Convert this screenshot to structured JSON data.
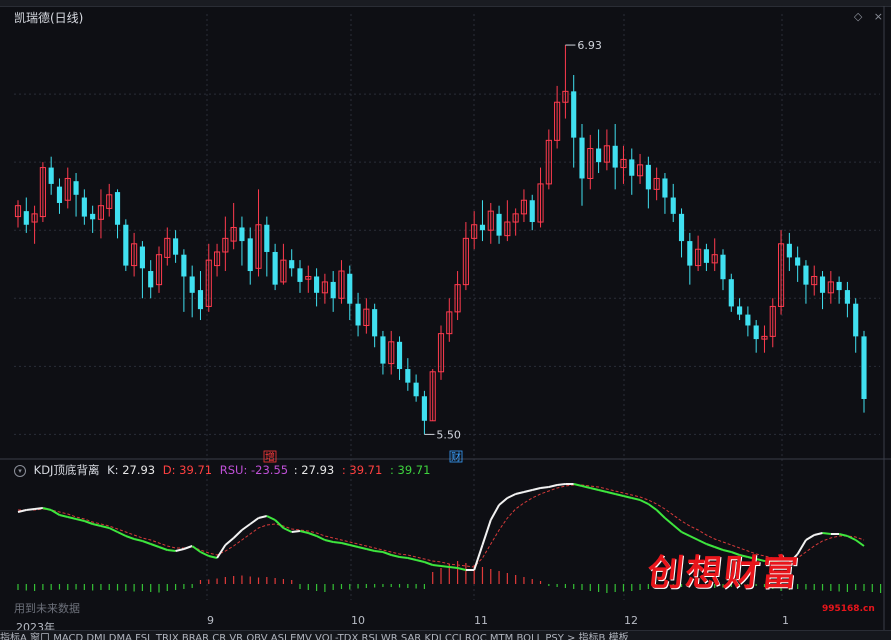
{
  "panel": {
    "title": "凯瑞德(日线)",
    "icons": [
      "diamond-icon",
      "close-icon"
    ]
  },
  "price_labels": {
    "high": "6.93",
    "low": "5.50"
  },
  "markers": [
    {
      "text": "增",
      "color": "#ff3b3b"
    },
    {
      "text": "财",
      "color": "#3aa0ff"
    }
  ],
  "indicator": {
    "toggle_icon": "chevron-down-icon",
    "name": "KDJ顶底背离",
    "k_label": "K:",
    "k_value": "27.93",
    "d_label": "D:",
    "d_value": "39.71",
    "rsu_label": "RSU:",
    "rsu_value": "-23.55",
    "v1": ": 27.93",
    "v2": ": 39.71",
    "v3": ": 39.71"
  },
  "note": "用到未来数据",
  "x_axis": {
    "year": "2023年",
    "months": [
      "9",
      "10",
      "11",
      "12",
      "1"
    ]
  },
  "bottom_tabs": "指标A  窗口  MACD  DMI  DMA  FSL  TRIX  BRAR  CR  VR  OBV  ASI  EMV  VOL-TDX  RSI  WR  SAR  KDJ  CCI  ROC  MTM  BOLL  PSY  >   指标B  模板",
  "watermark": {
    "text": "创想财富",
    "url": "995168.cn"
  },
  "chart_data": {
    "type": "candlestick",
    "title": "凯瑞德(日线)",
    "annotated_high": 6.93,
    "annotated_low": 5.5,
    "ylim": [
      5.45,
      7.0
    ],
    "candles": [
      [
        6.3,
        6.34,
        6.26,
        6.36
      ],
      [
        6.32,
        6.27,
        6.24,
        6.37
      ],
      [
        6.28,
        6.31,
        6.2,
        6.34
      ],
      [
        6.3,
        6.48,
        6.28,
        6.5
      ],
      [
        6.48,
        6.42,
        6.38,
        6.52
      ],
      [
        6.41,
        6.35,
        6.31,
        6.44
      ],
      [
        6.36,
        6.44,
        6.33,
        6.48
      ],
      [
        6.43,
        6.38,
        6.3,
        6.46
      ],
      [
        6.37,
        6.3,
        6.27,
        6.4
      ],
      [
        6.31,
        6.29,
        6.24,
        6.34
      ],
      [
        6.29,
        6.34,
        6.22,
        6.4
      ],
      [
        6.33,
        6.38,
        6.3,
        6.42
      ],
      [
        6.39,
        6.27,
        6.22,
        6.4
      ],
      [
        6.27,
        6.12,
        6.1,
        6.29
      ],
      [
        6.12,
        6.2,
        6.08,
        6.24
      ],
      [
        6.19,
        6.11,
        6.0,
        6.21
      ],
      [
        6.1,
        6.04,
        6.0,
        6.14
      ],
      [
        6.05,
        6.16,
        6.02,
        6.19
      ],
      [
        6.15,
        6.22,
        6.12,
        6.26
      ],
      [
        6.22,
        6.16,
        6.13,
        6.25
      ],
      [
        6.16,
        6.08,
        5.95,
        6.18
      ],
      [
        6.08,
        6.02,
        5.93,
        6.12
      ],
      [
        6.03,
        5.96,
        5.92,
        6.1
      ],
      [
        5.97,
        6.14,
        5.95,
        6.2
      ],
      [
        6.12,
        6.17,
        6.08,
        6.2
      ],
      [
        6.17,
        6.22,
        6.1,
        6.3
      ],
      [
        6.21,
        6.26,
        6.18,
        6.35
      ],
      [
        6.26,
        6.21,
        6.12,
        6.3
      ],
      [
        6.22,
        6.1,
        6.05,
        6.26
      ],
      [
        6.11,
        6.27,
        6.08,
        6.4
      ],
      [
        6.27,
        6.17,
        6.08,
        6.3
      ],
      [
        6.17,
        6.05,
        6.03,
        6.2
      ],
      [
        6.06,
        6.14,
        6.05,
        6.2
      ],
      [
        6.14,
        6.11,
        6.08,
        6.18
      ],
      [
        6.11,
        6.06,
        6.02,
        6.14
      ],
      [
        6.07,
        6.08,
        6.02,
        6.12
      ],
      [
        6.08,
        6.02,
        5.97,
        6.11
      ],
      [
        6.02,
        6.06,
        5.98,
        6.09
      ],
      [
        6.06,
        6.0,
        5.95,
        6.1
      ],
      [
        6.0,
        6.1,
        5.98,
        6.14
      ],
      [
        6.09,
        5.98,
        5.92,
        6.12
      ],
      [
        5.98,
        5.9,
        5.86,
        6.02
      ],
      [
        5.9,
        5.96,
        5.87,
        6.0
      ],
      [
        5.96,
        5.86,
        5.82,
        5.98
      ],
      [
        5.86,
        5.76,
        5.72,
        5.88
      ],
      [
        5.76,
        5.84,
        5.72,
        5.88
      ],
      [
        5.84,
        5.74,
        5.7,
        5.86
      ],
      [
        5.74,
        5.69,
        5.66,
        5.78
      ],
      [
        5.69,
        5.64,
        5.62,
        5.72
      ],
      [
        5.64,
        5.55,
        5.5,
        5.66
      ],
      [
        5.55,
        5.73,
        5.55,
        5.74
      ],
      [
        5.73,
        5.87,
        5.7,
        5.9
      ],
      [
        5.87,
        5.95,
        5.84,
        6.0
      ],
      [
        5.95,
        6.05,
        5.92,
        6.1
      ],
      [
        6.05,
        6.22,
        6.03,
        6.28
      ],
      [
        6.22,
        6.27,
        6.18,
        6.32
      ],
      [
        6.27,
        6.25,
        6.21,
        6.36
      ],
      [
        6.25,
        6.32,
        6.2,
        6.35
      ],
      [
        6.31,
        6.23,
        6.2,
        6.34
      ],
      [
        6.23,
        6.28,
        6.21,
        6.36
      ],
      [
        6.28,
        6.31,
        6.23,
        6.33
      ],
      [
        6.31,
        6.36,
        6.28,
        6.4
      ],
      [
        6.36,
        6.28,
        6.25,
        6.38
      ],
      [
        6.28,
        6.42,
        6.26,
        6.48
      ],
      [
        6.42,
        6.58,
        6.4,
        6.62
      ],
      [
        6.58,
        6.72,
        6.55,
        6.78
      ],
      [
        6.72,
        6.76,
        6.66,
        6.93
      ],
      [
        6.76,
        6.59,
        6.48,
        6.82
      ],
      [
        6.59,
        6.44,
        6.34,
        6.64
      ],
      [
        6.44,
        6.55,
        6.4,
        6.6
      ],
      [
        6.55,
        6.5,
        6.46,
        6.62
      ],
      [
        6.5,
        6.56,
        6.47,
        6.62
      ],
      [
        6.56,
        6.48,
        6.4,
        6.64
      ],
      [
        6.48,
        6.51,
        6.42,
        6.56
      ],
      [
        6.51,
        6.45,
        6.38,
        6.55
      ],
      [
        6.45,
        6.49,
        6.42,
        6.53
      ],
      [
        6.49,
        6.4,
        6.33,
        6.52
      ],
      [
        6.4,
        6.44,
        6.36,
        6.48
      ],
      [
        6.44,
        6.37,
        6.31,
        6.46
      ],
      [
        6.37,
        6.31,
        6.28,
        6.42
      ],
      [
        6.31,
        6.21,
        6.15,
        6.33
      ],
      [
        6.21,
        6.12,
        6.05,
        6.24
      ],
      [
        6.12,
        6.18,
        6.1,
        6.23
      ],
      [
        6.18,
        6.13,
        6.1,
        6.2
      ],
      [
        6.13,
        6.16,
        6.1,
        6.22
      ],
      [
        6.16,
        6.07,
        6.03,
        6.18
      ],
      [
        6.07,
        5.97,
        5.95,
        6.09
      ],
      [
        5.97,
        5.94,
        5.92,
        6.0
      ],
      [
        5.94,
        5.9,
        5.86,
        5.97
      ],
      [
        5.9,
        5.85,
        5.8,
        5.92
      ],
      [
        5.85,
        5.86,
        5.8,
        5.9
      ],
      [
        5.86,
        5.97,
        5.82,
        6.0
      ],
      [
        5.97,
        6.2,
        5.94,
        6.25
      ],
      [
        6.2,
        6.15,
        6.1,
        6.24
      ],
      [
        6.15,
        6.12,
        6.06,
        6.19
      ],
      [
        6.12,
        6.05,
        5.98,
        6.14
      ],
      [
        6.05,
        6.08,
        6.01,
        6.12
      ],
      [
        6.08,
        6.02,
        5.96,
        6.1
      ],
      [
        6.02,
        6.06,
        5.98,
        6.1
      ],
      [
        6.06,
        6.03,
        5.98,
        6.08
      ],
      [
        6.03,
        5.98,
        5.93,
        6.06
      ],
      [
        5.98,
        5.86,
        5.8,
        6.0
      ],
      [
        5.86,
        5.63,
        5.58,
        5.88
      ]
    ]
  },
  "kdj_chart": {
    "type": "line",
    "ylim": [
      0,
      100
    ],
    "k": [
      68,
      70,
      71,
      72,
      70,
      65,
      63,
      61,
      59,
      56,
      54,
      52,
      48,
      44,
      41,
      39,
      36,
      33,
      30,
      29,
      31,
      34,
      28,
      24,
      22,
      35,
      42,
      50,
      56,
      62,
      64,
      60,
      52,
      48,
      49,
      47,
      44,
      40,
      38,
      37,
      35,
      33,
      31,
      29,
      28,
      25,
      23,
      22,
      20,
      18,
      15,
      14,
      13,
      12,
      10,
      10,
      35,
      60,
      75,
      82,
      86,
      88,
      90,
      92,
      93,
      95,
      96,
      96,
      94,
      92,
      90,
      88,
      86,
      84,
      82,
      80,
      76,
      70,
      62,
      55,
      48,
      44,
      40,
      36,
      33,
      30,
      28,
      25,
      23,
      21,
      19,
      18,
      17,
      17,
      26,
      40,
      45,
      47,
      46,
      46,
      44,
      40,
      34
    ],
    "d": [
      70,
      70,
      70,
      71,
      70,
      68,
      66,
      63,
      61,
      58,
      56,
      54,
      51,
      48,
      45,
      42,
      40,
      37,
      34,
      32,
      32,
      33,
      30,
      27,
      25,
      29,
      34,
      40,
      46,
      52,
      55,
      56,
      54,
      51,
      50,
      49,
      47,
      44,
      42,
      40,
      38,
      36,
      34,
      32,
      30,
      28,
      26,
      25,
      23,
      21,
      19,
      18,
      16,
      15,
      14,
      13,
      22,
      36,
      50,
      62,
      71,
      77,
      82,
      86,
      89,
      92,
      94,
      95,
      95,
      94,
      93,
      91,
      89,
      87,
      85,
      83,
      80,
      76,
      71,
      65,
      59,
      54,
      50,
      45,
      41,
      38,
      35,
      32,
      29,
      26,
      24,
      22,
      21,
      20,
      22,
      28,
      34,
      39,
      42,
      44,
      44,
      43,
      40
    ],
    "macd": [
      -12,
      -13,
      -14,
      -12,
      -12,
      -11,
      -12,
      -11,
      -12,
      -13,
      -12,
      -12,
      -13,
      -14,
      -15,
      -14,
      -16,
      -17,
      -14,
      -12,
      -10,
      -8,
      8,
      9,
      11,
      14,
      16,
      17,
      15,
      13,
      14,
      12,
      10,
      8,
      -10,
      -12,
      -14,
      -16,
      -12,
      -10,
      -11,
      -9,
      -8,
      -7,
      -6,
      -6,
      -7,
      -8,
      -9,
      -10,
      24,
      32,
      40,
      46,
      42,
      38,
      34,
      30,
      26,
      22,
      18,
      14,
      10,
      6,
      -4,
      -6,
      -8,
      -10,
      -12,
      -14,
      -16,
      -18,
      -16,
      -15,
      -14,
      -12,
      -10,
      -9,
      -8,
      -7,
      -6,
      -6,
      -7,
      -8,
      -8,
      -7,
      -6,
      -6,
      -5,
      -4,
      -6,
      -10,
      -14,
      -12,
      -10,
      -11,
      -12,
      -13,
      -14,
      -15,
      -16,
      -12,
      -14,
      -16,
      -18
    ]
  }
}
